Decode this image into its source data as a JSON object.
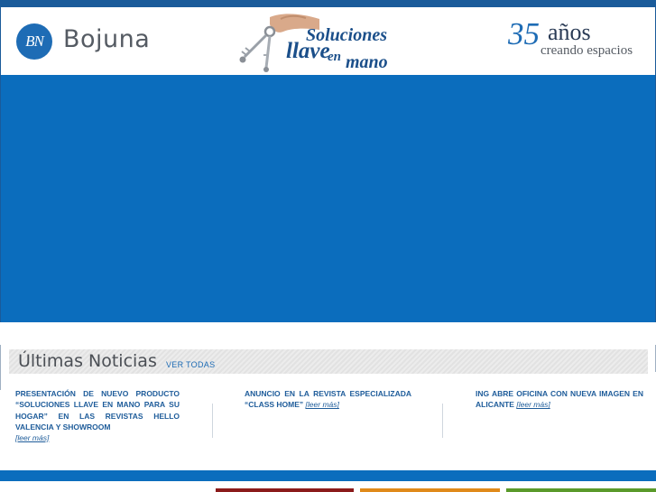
{
  "header": {
    "logo": {
      "monogram": "BN",
      "name": "Bojuna"
    },
    "slogan": {
      "line1": "Soluciones",
      "line2": "llave",
      "line3": "en",
      "line4": "mano"
    },
    "anniversary": {
      "number": "35",
      "word": "años",
      "subtitle": "creando espacios"
    }
  },
  "news": {
    "title": "Últimas Noticias",
    "view_all": "VER TODAS",
    "items": [
      {
        "text": "PRESENTACIÓN DE NUEVO PRODUCTO “SOLUCIONES LLAVE EN MANO PARA SU HOGAR” EN LAS REVISTAS HELLO VALENCIA Y SHOWROOM",
        "more": "[leer más]"
      },
      {
        "text": "ANUNCIO EN LA REVISTA ESPECIALIZADA “CLASS HOME”",
        "more": "[leer más]"
      },
      {
        "text": "ING ABRE OFICINA CON NUEVA IMAGEN EN ALICANTE",
        "more": "[leer más]"
      }
    ]
  },
  "colors": {
    "brand_blue": "#0b6dbd",
    "text_blue": "#1e5c9a",
    "slogan_blue": "#1b4f8a"
  }
}
